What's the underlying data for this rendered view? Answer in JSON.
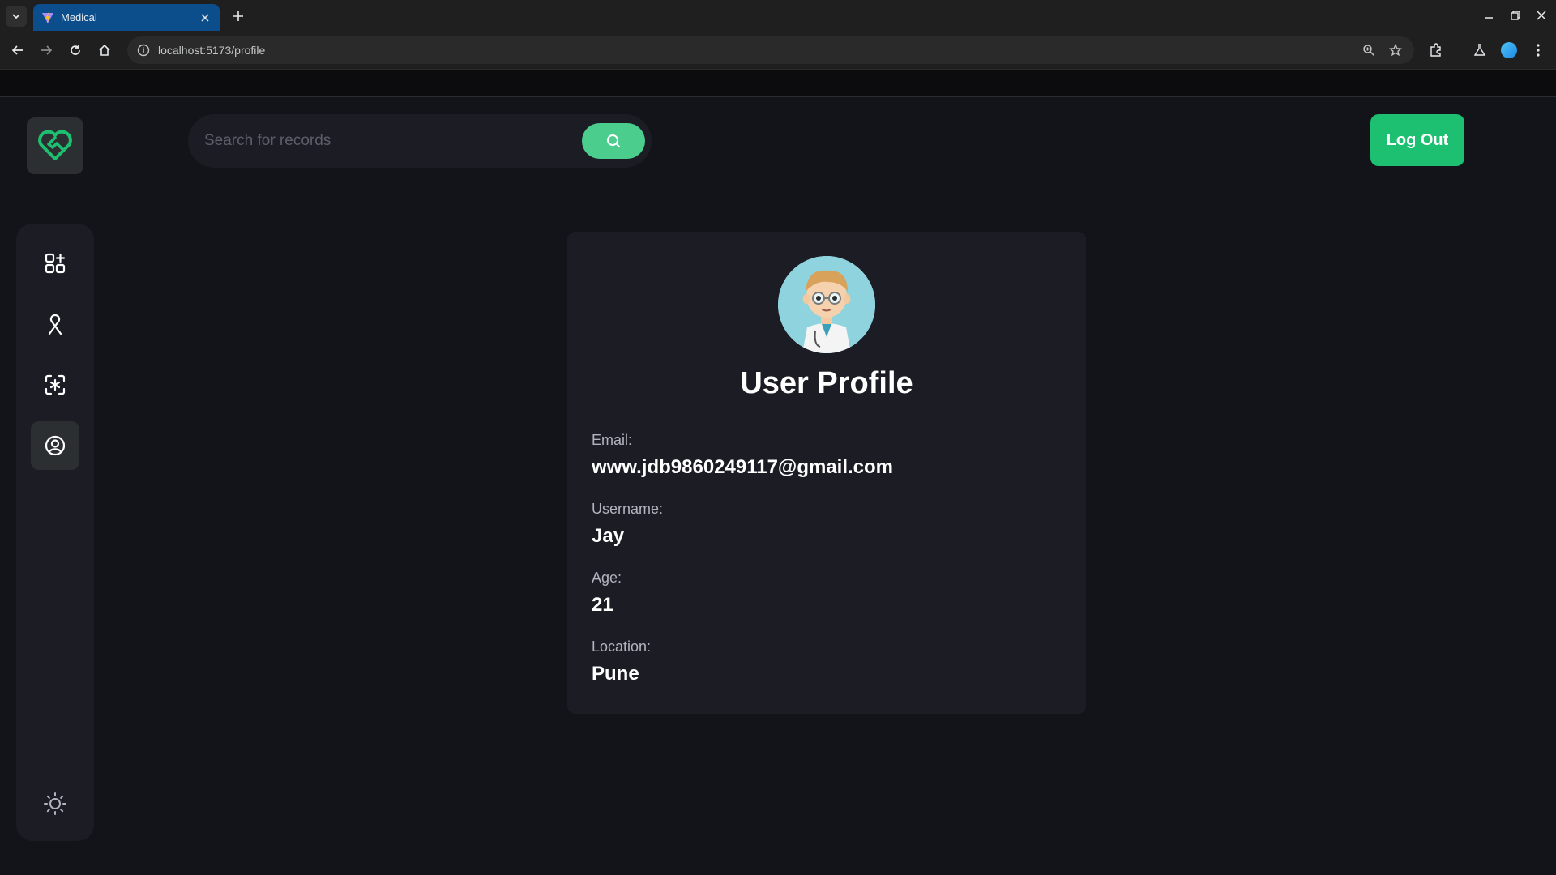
{
  "browser": {
    "tab_title": "Medical",
    "url": "localhost:5173/profile"
  },
  "header": {
    "search_placeholder": "Search for records",
    "logout_label": "Log Out"
  },
  "sidebar": {
    "items": [
      {
        "icon": "dashboard-add-icon",
        "active": false
      },
      {
        "icon": "ribbon-icon",
        "active": false
      },
      {
        "icon": "scan-icon",
        "active": false
      },
      {
        "icon": "user-profile-icon",
        "active": true
      }
    ],
    "theme_icon": "sun-icon"
  },
  "profile": {
    "title": "User Profile",
    "fields": [
      {
        "label": "Email:",
        "value": "www.jdb9860249117@gmail.com"
      },
      {
        "label": "Username:",
        "value": "Jay"
      },
      {
        "label": "Age:",
        "value": "21"
      },
      {
        "label": "Location:",
        "value": "Pune"
      }
    ]
  },
  "colors": {
    "accent": "#1dc071",
    "search_button": "#4acd8d",
    "background": "#13131a",
    "panel": "#1c1c24"
  }
}
